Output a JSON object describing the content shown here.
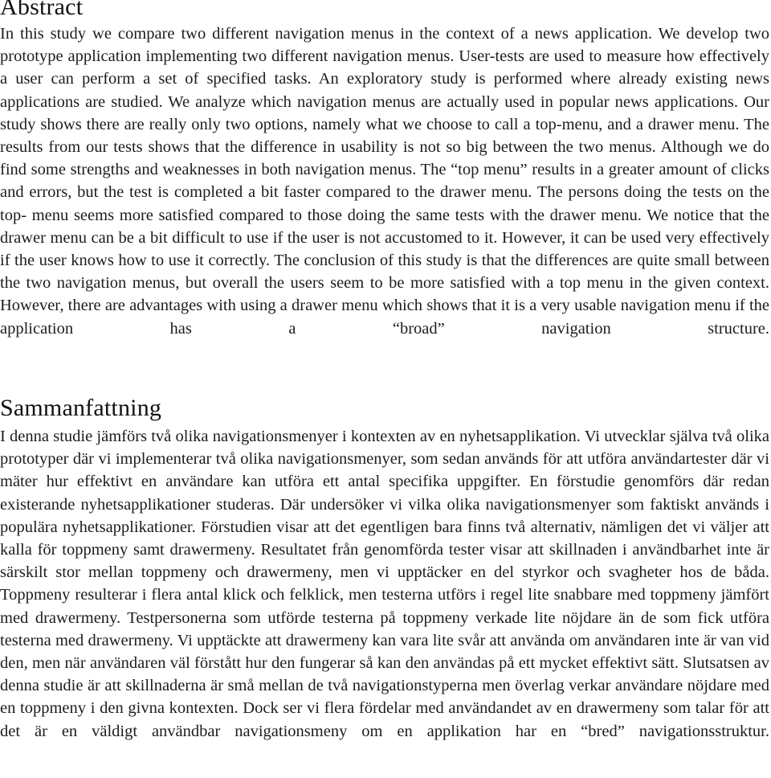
{
  "document": {
    "type": "academic-paper-abstract-page",
    "language_primary": "English",
    "language_secondary": "Swedish"
  },
  "abstract": {
    "heading": "Abstract",
    "body": "In this study we compare two different navigation menus in the context of a news application. We develop two prototype application implementing two different navigation menus. User-tests are used to measure how effectively a user can perform a set of specified tasks. An exploratory study is performed where already existing news applications are studied. We analyze which navigation menus are actually used in popular news applications. Our study shows there are really only two options, namely what we choose to call a top-menu, and a drawer menu. The results from our tests shows that the difference in usability is not so big between the two menus. Although we do find some strengths and weaknesses in both navigation menus. The “top menu” results in a greater amount of clicks and errors, but the test is completed a bit faster compared to the drawer menu. The persons doing the tests on the top- menu seems more satisfied compared to those doing the same tests with the drawer menu. We notice that the drawer menu can be a bit difficult to use if the user is not accustomed to it. However, it can be used very effectively if the user knows how to use it correctly. The conclusion of this study is that the differences are quite small between the two navigation menus, but overall the users seem to be more satisfied with a top menu in the given context. However, there are advantages with using a drawer menu which shows that it is a very usable navigation menu if the application has a “broad” navigation structure."
  },
  "sammanfattning": {
    "heading": "Sammanfattning",
    "body": "I denna studie jämförs två olika navigationsmenyer i kontexten av en nyhetsapplikation. Vi utvecklar själva två olika prototyper där vi implementerar två olika navigationsmenyer, som sedan används för att utföra användartester där vi mäter hur effektivt en användare kan utföra ett antal specifika uppgifter. En förstudie genomförs där redan existerande nyhetsapplikationer studeras. Där undersöker vi vilka olika navigationsmenyer som faktiskt används i populära nyhetsapplikationer. Förstudien visar att det egentligen bara finns två alternativ, nämligen det vi väljer att kalla för toppmeny samt drawermeny. Resultatet från genomförda tester visar att skillnaden i användbarhet inte är särskilt stor mellan toppmeny och drawermeny, men vi upptäcker en del styrkor och svagheter hos de båda. Toppmeny resulterar i flera antal klick och felklick, men testerna utförs i regel lite snabbare med toppmeny jämfört med drawermeny. Testpersonerna som utförde testerna på toppmeny verkade lite nöjdare än de som fick utföra testerna med drawermeny. Vi upptäckte att drawermeny kan vara lite svår att använda om användaren inte är van vid den, men när användaren väl förstått hur den fungerar så kan den användas på ett mycket effektivt sätt. Slutsatsen av denna studie är att skillnaderna är små mellan de två navigationstyperna men överlag verkar användare nöjdare med en toppmeny i den givna kontexten. Dock ser vi flera fördelar med användandet av en drawermeny som talar för att det är en väldigt användbar navigationsmeny om en applikation har en “bred” navigationsstruktur."
  },
  "colors": {
    "page_background": "#ffffff",
    "text": "#1c1c1c",
    "heading": "#111111"
  }
}
